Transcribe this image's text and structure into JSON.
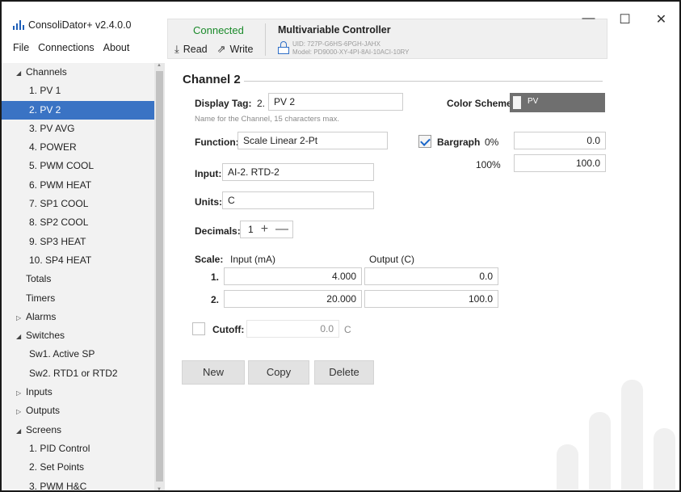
{
  "app": {
    "title": "ConsoliDator+ v2.4.0.0"
  },
  "menu": [
    "File",
    "Connections",
    "About"
  ],
  "status": {
    "connection": "Connected",
    "read_label": "Read",
    "write_label": "Write",
    "controller_name": "Multivariable Controller",
    "uid": "UID: 727P-G6HS-6PGH-JAHX",
    "model": "Model: PD9000-XY-4PI-8AI-10ACI-10RY",
    "connected_color": "#1a8a2a"
  },
  "window_controls": {
    "minimize": "—",
    "maximize": "☐",
    "close": "✕"
  },
  "sidebar": {
    "items": [
      {
        "label": "Channels",
        "arrow": "◢",
        "level": 0,
        "selected": false
      },
      {
        "label": "1. PV 1",
        "arrow": "",
        "level": 1,
        "selected": false
      },
      {
        "label": "2. PV 2",
        "arrow": "",
        "level": 1,
        "selected": true
      },
      {
        "label": "3. PV AVG",
        "arrow": "",
        "level": 1,
        "selected": false
      },
      {
        "label": "4. POWER",
        "arrow": "",
        "level": 1,
        "selected": false
      },
      {
        "label": "5. PWM COOL",
        "arrow": "",
        "level": 1,
        "selected": false
      },
      {
        "label": "6. PWM HEAT",
        "arrow": "",
        "level": 1,
        "selected": false
      },
      {
        "label": "7. SP1 COOL",
        "arrow": "",
        "level": 1,
        "selected": false
      },
      {
        "label": "8. SP2 COOL",
        "arrow": "",
        "level": 1,
        "selected": false
      },
      {
        "label": "9. SP3 HEAT",
        "arrow": "",
        "level": 1,
        "selected": false
      },
      {
        "label": "10. SP4 HEAT",
        "arrow": "",
        "level": 1,
        "selected": false
      },
      {
        "label": "Totals",
        "arrow": "",
        "level": 0,
        "selected": false
      },
      {
        "label": "Timers",
        "arrow": "",
        "level": 0,
        "selected": false
      },
      {
        "label": "Alarms",
        "arrow": "▷",
        "level": 0,
        "selected": false
      },
      {
        "label": "Switches",
        "arrow": "◢",
        "level": 0,
        "selected": false
      },
      {
        "label": "Sw1. Active SP",
        "arrow": "",
        "level": 1,
        "selected": false
      },
      {
        "label": "Sw2. RTD1 or RTD2",
        "arrow": "",
        "level": 1,
        "selected": false
      },
      {
        "label": "Inputs",
        "arrow": "▷",
        "level": 0,
        "selected": false
      },
      {
        "label": "Outputs",
        "arrow": "▷",
        "level": 0,
        "selected": false
      },
      {
        "label": "Screens",
        "arrow": "◢",
        "level": 0,
        "selected": false
      },
      {
        "label": "1. PID Control",
        "arrow": "",
        "level": 1,
        "selected": false
      },
      {
        "label": "2. Set Points",
        "arrow": "",
        "level": 1,
        "selected": false
      },
      {
        "label": "3. PWM H&C",
        "arrow": "",
        "level": 1,
        "selected": false
      }
    ],
    "selected_color": "#3a73c4"
  },
  "channel": {
    "section_title": "Channel 2",
    "display_tag_label": "Display Tag:",
    "display_tag_number": "2.",
    "display_tag_value": "PV 2",
    "display_tag_hint": "Name for the Channel, 15 characters max.",
    "color_scheme_label": "Color Scheme:",
    "color_scheme_value": "PV",
    "function_label": "Function:",
    "function_value": "Scale Linear 2-Pt",
    "bargraph_label": "Bargraph",
    "bargraph_checked": true,
    "bargraph_low_label": "0%",
    "bargraph_low_value": "0.0",
    "bargraph_high_label": "100%",
    "bargraph_high_value": "100.0",
    "input_label": "Input:",
    "input_value": "AI-2. RTD-2",
    "units_label": "Units:",
    "units_value": "C",
    "decimals_label": "Decimals:",
    "decimals_value": "1",
    "decimals_plus": "+",
    "decimals_minus": "—",
    "scale_label": "Scale:",
    "scale_input_header": "Input (mA)",
    "scale_output_header": "Output (C)",
    "scale_rows": [
      {
        "index": "1.",
        "input": "4.000",
        "output": "0.0"
      },
      {
        "index": "2.",
        "input": "20.000",
        "output": "100.0"
      }
    ],
    "cutoff_label": "Cutoff:",
    "cutoff_checked": false,
    "cutoff_value": "0.0",
    "cutoff_unit": "C"
  },
  "actions": {
    "new_label": "New",
    "copy_label": "Copy",
    "delete_label": "Delete"
  }
}
